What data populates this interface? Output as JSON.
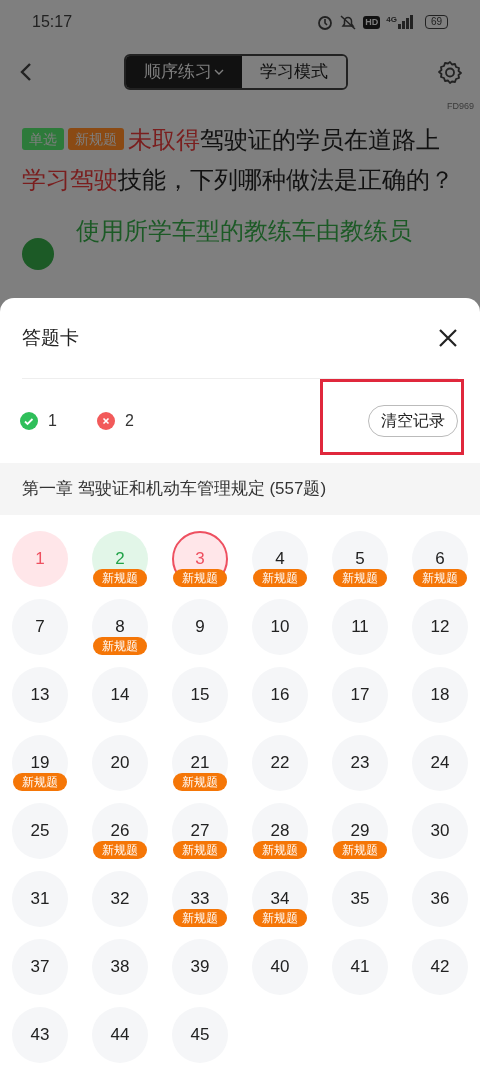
{
  "status_bar": {
    "time": "15:17",
    "hd": "HD",
    "network": "4G",
    "battery": "69"
  },
  "nav": {
    "modes": [
      {
        "label": "顺序练习",
        "selected": true,
        "dropdown": true
      },
      {
        "label": "学习模式",
        "selected": false,
        "dropdown": false
      }
    ]
  },
  "code": "FD969",
  "question": {
    "tags": [
      {
        "label": "单选",
        "color": "#2d7a3a"
      },
      {
        "label": "新规题",
        "color": "#8a4a14"
      }
    ],
    "segments": [
      {
        "text": "未取得",
        "highlight": true
      },
      {
        "text": "驾驶证的学员在道路上",
        "highlight": false
      },
      {
        "text": "学习驾驶",
        "highlight": true
      },
      {
        "text": "技能，下列哪种做法是正确的？",
        "highlight": false
      }
    ],
    "option": {
      "text": "使用所学车型的教练车由教练员",
      "correct": true
    }
  },
  "answer_card": {
    "title": "答题卡",
    "stats": [
      {
        "kind": "correct",
        "count": "1"
      },
      {
        "kind": "wrong",
        "count": "2"
      }
    ],
    "clear_button": {
      "label": "清空记录",
      "highlighted": true
    },
    "chapter": "第一章  驾驶证和机动车管理规定 (557题)",
    "items": [
      {
        "number": "1",
        "kind": "wrong",
        "current": false
      },
      {
        "number": "2",
        "kind": "correct",
        "current": false,
        "badge": "新规题"
      },
      {
        "number": "3",
        "kind": "wrong",
        "current": true,
        "badge": "新规题"
      },
      {
        "number": "4",
        "kind": "none",
        "current": false,
        "badge": "新规题"
      },
      {
        "number": "5",
        "kind": "none",
        "current": false,
        "badge": "新规题"
      },
      {
        "number": "6",
        "kind": "none",
        "current": false,
        "badge": "新规题"
      },
      {
        "number": "7",
        "kind": "none",
        "current": false
      },
      {
        "number": "8",
        "kind": "none",
        "current": false,
        "badge": "新规题"
      },
      {
        "number": "9",
        "kind": "none",
        "current": false
      },
      {
        "number": "10",
        "kind": "none",
        "current": false
      },
      {
        "number": "11",
        "kind": "none",
        "current": false
      },
      {
        "number": "12",
        "kind": "none",
        "current": false
      },
      {
        "number": "13",
        "kind": "none",
        "current": false
      },
      {
        "number": "14",
        "kind": "none",
        "current": false
      },
      {
        "number": "15",
        "kind": "none",
        "current": false
      },
      {
        "number": "16",
        "kind": "none",
        "current": false
      },
      {
        "number": "17",
        "kind": "none",
        "current": false
      },
      {
        "number": "18",
        "kind": "none",
        "current": false
      },
      {
        "number": "19",
        "kind": "none",
        "current": false,
        "badge": "新规题"
      },
      {
        "number": "20",
        "kind": "none",
        "current": false
      },
      {
        "number": "21",
        "kind": "none",
        "current": false,
        "badge": "新规题"
      },
      {
        "number": "22",
        "kind": "none",
        "current": false
      },
      {
        "number": "23",
        "kind": "none",
        "current": false
      },
      {
        "number": "24",
        "kind": "none",
        "current": false
      },
      {
        "number": "25",
        "kind": "none",
        "current": false
      },
      {
        "number": "26",
        "kind": "none",
        "current": false,
        "badge": "新规题"
      },
      {
        "number": "27",
        "kind": "none",
        "current": false,
        "badge": "新规题"
      },
      {
        "number": "28",
        "kind": "none",
        "current": false,
        "badge": "新规题"
      },
      {
        "number": "29",
        "kind": "none",
        "current": false,
        "badge": "新规题"
      },
      {
        "number": "30",
        "kind": "none",
        "current": false
      },
      {
        "number": "31",
        "kind": "none",
        "current": false
      },
      {
        "number": "32",
        "kind": "none",
        "current": false
      },
      {
        "number": "33",
        "kind": "none",
        "current": false,
        "badge": "新规题"
      },
      {
        "number": "34",
        "kind": "none",
        "current": false,
        "badge": "新规题"
      },
      {
        "number": "35",
        "kind": "none",
        "current": false
      },
      {
        "number": "36",
        "kind": "none",
        "current": false
      },
      {
        "number": "37",
        "kind": "none",
        "current": false
      },
      {
        "number": "38",
        "kind": "none",
        "current": false
      },
      {
        "number": "39",
        "kind": "none",
        "current": false
      },
      {
        "number": "40",
        "kind": "none",
        "current": false
      },
      {
        "number": "41",
        "kind": "none",
        "current": false
      },
      {
        "number": "42",
        "kind": "none",
        "current": false
      },
      {
        "number": "43",
        "kind": "none",
        "current": false
      },
      {
        "number": "44",
        "kind": "none",
        "current": false
      },
      {
        "number": "45",
        "kind": "none",
        "current": false
      }
    ]
  }
}
